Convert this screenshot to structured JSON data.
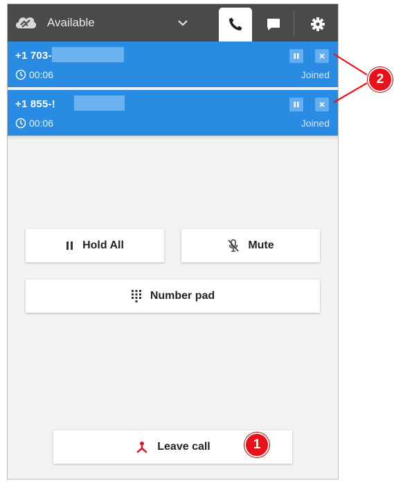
{
  "header": {
    "status_label": "Available",
    "icons": [
      "cloud-icon",
      "chevron-down-icon",
      "phone-icon",
      "chat-icon",
      "gear-icon"
    ]
  },
  "calls": [
    {
      "number": "+1 703-",
      "time": "00:06",
      "status": "Joined"
    },
    {
      "number": "+1 855-!",
      "time": "00:06",
      "status": "Joined"
    }
  ],
  "actions": {
    "hold_all": "Hold All",
    "mute": "Mute",
    "number_pad": "Number pad",
    "leave_call": "Leave call"
  },
  "annotations": {
    "badge_1": "1",
    "badge_2": "2"
  },
  "colors": {
    "header_bg": "#4a4a4a",
    "call_bg": "#2a8be2",
    "leave_icon": "#d01f2b",
    "badge": "#e8101a"
  }
}
